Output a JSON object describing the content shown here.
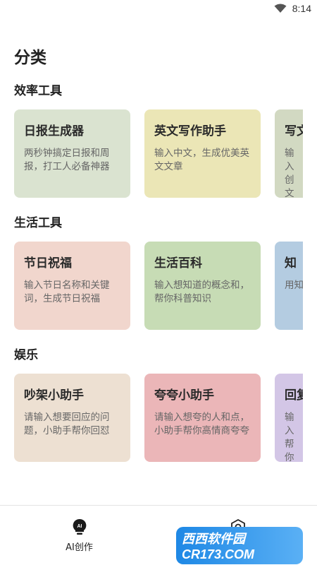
{
  "status_bar": {
    "time": "8:14"
  },
  "page": {
    "title": "分类"
  },
  "sections": [
    {
      "title": "效率工具",
      "cards": [
        {
          "title": "日报生成器",
          "desc": "两秒钟搞定日报和周报，打工人必备神器",
          "color": "#dae3d0"
        },
        {
          "title": "英文写作助手",
          "desc": "输入中文，生成优美英文文章",
          "color": "#ebe6b6"
        },
        {
          "title": "写文",
          "desc": "输入创文",
          "color": "#d2d9c2"
        }
      ]
    },
    {
      "title": "生活工具",
      "cards": [
        {
          "title": "节日祝福",
          "desc": "输入节日名称和关键词，生成节日祝福",
          "color": "#f1d6cd"
        },
        {
          "title": "生活百科",
          "desc": "输入想知道的概念和，帮你科普知识",
          "color": "#c7dcb5"
        },
        {
          "title": "知",
          "desc": "用知",
          "color": "#b4cce1"
        }
      ]
    },
    {
      "title": "娱乐",
      "cards": [
        {
          "title": "吵架小助手",
          "desc": "请输入想要回应的问题，小助手帮你回怼",
          "color": "#ede0d2"
        },
        {
          "title": "夸夸小助手",
          "desc": "请输入想夸的人和点，小助手帮你高情商夸夸",
          "color": "#ebb6b8"
        },
        {
          "title": "回复",
          "desc": "输入帮你本",
          "color": "#d3c6e6"
        }
      ]
    }
  ],
  "bottom_nav": {
    "items": [
      {
        "label": "AI创作",
        "icon": "ai-bulb-icon",
        "active": true
      },
      {
        "label": "",
        "icon": "settings-hex-icon",
        "active": false
      }
    ]
  },
  "watermark": {
    "text": "西西软件园",
    "sub": "CR173.COM"
  }
}
